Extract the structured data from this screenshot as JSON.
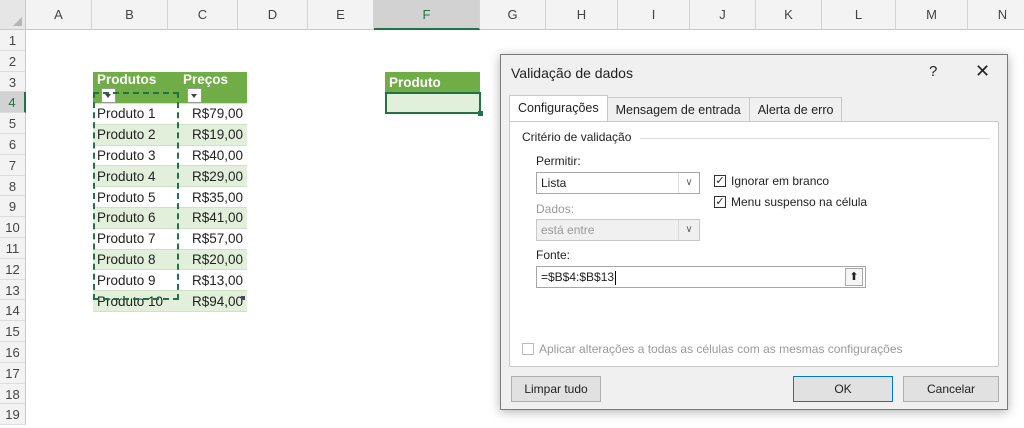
{
  "columns": [
    "A",
    "B",
    "C",
    "D",
    "E",
    "F",
    "G",
    "H",
    "I",
    "J",
    "K",
    "L",
    "M",
    "N"
  ],
  "rows": [
    "1",
    "2",
    "3",
    "4",
    "5",
    "6",
    "7",
    "8",
    "9",
    "10",
    "11",
    "12",
    "13",
    "14",
    "15",
    "16",
    "17",
    "18",
    "19"
  ],
  "table": {
    "header": [
      "Produtos",
      "Preços"
    ],
    "rows": [
      [
        "Produto 1",
        "R$79,00"
      ],
      [
        "Produto 2",
        "R$19,00"
      ],
      [
        "Produto 3",
        "R$40,00"
      ],
      [
        "Produto 4",
        "R$29,00"
      ],
      [
        "Produto 5",
        "R$35,00"
      ],
      [
        "Produto 6",
        "R$41,00"
      ],
      [
        "Produto 7",
        "R$57,00"
      ],
      [
        "Produto 8",
        "R$20,00"
      ],
      [
        "Produto 9",
        "R$13,00"
      ],
      [
        "Produto 10",
        "R$94,00"
      ]
    ]
  },
  "product_header": "Produto",
  "dialog": {
    "title": "Validação de dados",
    "help": "?",
    "close": "✕",
    "tabs": [
      "Configurações",
      "Mensagem de entrada",
      "Alerta de erro"
    ],
    "group_label": "Critério de validação",
    "permitir_label": "Permitir:",
    "permitir_value": "Lista",
    "dados_label": "Dados:",
    "dados_value": "está entre",
    "ignore_blank": "Ignorar em branco",
    "dropdown_in_cell": "Menu suspenso na célula",
    "fonte_label": "Fonte:",
    "fonte_value": "=$B$4:$B$13",
    "apply_all": "Aplicar alterações a todas as células com as mesmas configurações",
    "clear_all": "Limpar tudo",
    "ok": "OK",
    "cancel": "Cancelar"
  }
}
